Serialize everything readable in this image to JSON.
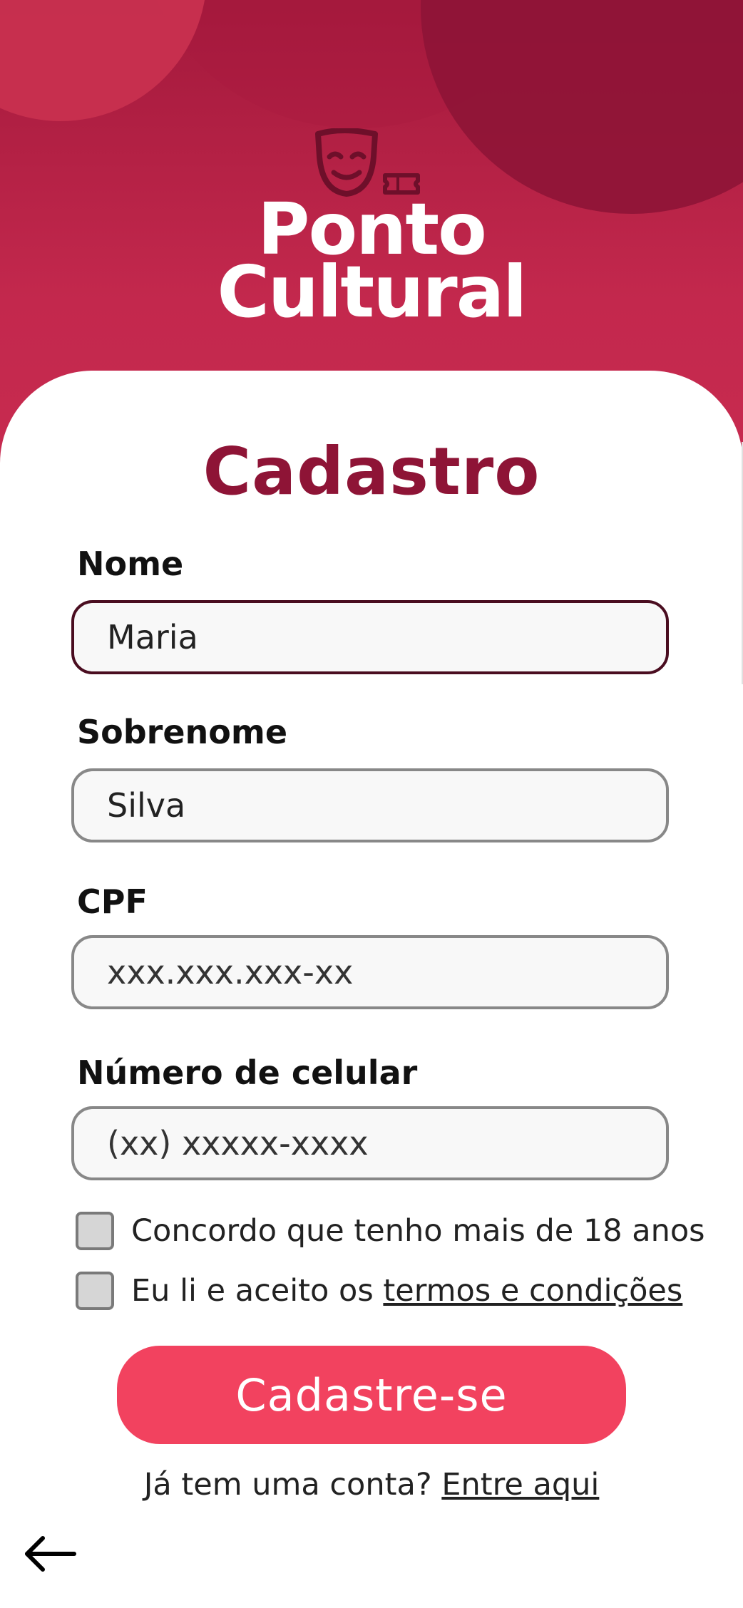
{
  "app": {
    "name_line1": "Ponto",
    "name_line2": "Cultural",
    "logo_icon": "theater-mask-ticket-icon"
  },
  "page": {
    "title": "Cadastro"
  },
  "form": {
    "fields": [
      {
        "label": "Nome",
        "value": "Maria",
        "placeholder": ""
      },
      {
        "label": "Sobrenome",
        "value": "Silva",
        "placeholder": ""
      },
      {
        "label": "CPF",
        "value": "",
        "placeholder": "xxx.xxx.xxx-xx"
      },
      {
        "label": "Número de celular",
        "value": "",
        "placeholder": "(xx) xxxxx-xxxx"
      }
    ],
    "checkboxes": [
      {
        "text": "Concordo que tenho mais de 18 anos",
        "checked": false
      },
      {
        "text_prefix": "Eu li e aceito os ",
        "link_text": "termos e condições",
        "checked": false
      }
    ],
    "submit_label": "Cadastre-se"
  },
  "footer": {
    "login_prompt": "Já tem uma conta? ",
    "login_link": "Entre aqui",
    "back_icon": "arrow-left-icon"
  },
  "colors": {
    "brand_primary": "#8e1436",
    "header_gradient": "#c3284d",
    "button": "#f2425f"
  }
}
